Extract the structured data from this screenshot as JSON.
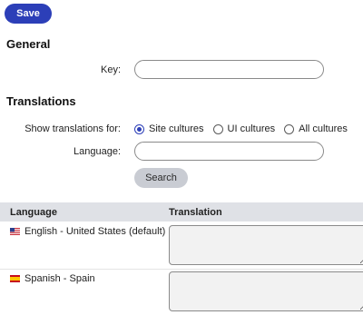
{
  "toolbar": {
    "save_label": "Save"
  },
  "general": {
    "heading": "General",
    "key_label": "Key:",
    "key_value": ""
  },
  "translations": {
    "heading": "Translations",
    "show_for_label": "Show translations for:",
    "options": [
      {
        "label": "Site cultures",
        "checked": true
      },
      {
        "label": "UI cultures",
        "checked": false
      },
      {
        "label": "All cultures",
        "checked": false
      }
    ],
    "language_label": "Language:",
    "language_value": "",
    "search_label": "Search"
  },
  "grid": {
    "columns": [
      "Language",
      "Translation"
    ],
    "rows": [
      {
        "language": "English - United States (default)",
        "flag_icon": "us-flag-icon",
        "translation": ""
      },
      {
        "language": "Spanish - Spain",
        "flag_icon": "es-flag-icon",
        "translation": ""
      }
    ]
  },
  "colors": {
    "primary": "#2c3fb8",
    "secondary_button": "#c9ccd3",
    "header_bg": "#dfe1e6"
  }
}
